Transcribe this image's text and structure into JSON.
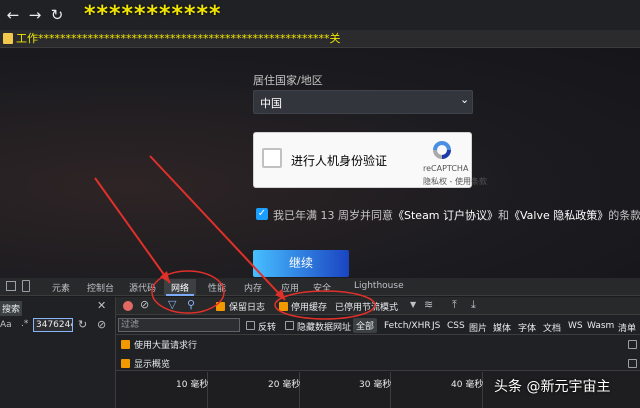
{
  "browser": {
    "url_mask": "***********",
    "bookmark_mask": "工作*****************************************************关"
  },
  "form": {
    "country_label": "居住国家/地区",
    "country_value": "中国",
    "recaptcha_label": "进行人机身份验证",
    "recaptcha_brand": "reCAPTCHA",
    "recaptcha_links": "隐私权 - 使用条款",
    "agree_prefix": "我已年满 13 周岁并同意",
    "agree_link1": "《Steam 订户协议》",
    "agree_middle": "和",
    "agree_link2": "《Valve 隐私政策》",
    "agree_suffix": "的条款。",
    "continue_label": "继续"
  },
  "devtools": {
    "tabs": [
      "元素",
      "控制台",
      "源代码",
      "网络",
      "性能",
      "内存",
      "应用",
      "安全",
      "Lighthouse"
    ],
    "sidebar": {
      "search_label": "搜索",
      "aa_label": "Aa",
      "regex_label": ".*",
      "search_value": "34762443"
    },
    "toolbar": {
      "preserve_log": "保留日志",
      "disable_cache": "停用缓存",
      "throttling": "已停用节流模式"
    },
    "filter": {
      "placeholder": "过滤",
      "invert": "反转",
      "hide_data_urls": "隐藏数据网址",
      "types": [
        "全部",
        "Fetch/XHR",
        "JS",
        "CSS",
        "图片",
        "媒体",
        "字体",
        "文档",
        "WS",
        "Wasm",
        "清单"
      ]
    },
    "options": {
      "big_rows": "使用大量请求行",
      "overview": "显示概览"
    },
    "timeline_ticks": [
      "10 毫秒",
      "20 毫秒",
      "30 毫秒",
      "40 毫秒"
    ]
  },
  "watermark": "头条 @新元宇宙主",
  "colors": {
    "accent_blue": "#1a9fff",
    "annotation_red": "#e0302a",
    "checkbox_orange": "#f29900"
  }
}
